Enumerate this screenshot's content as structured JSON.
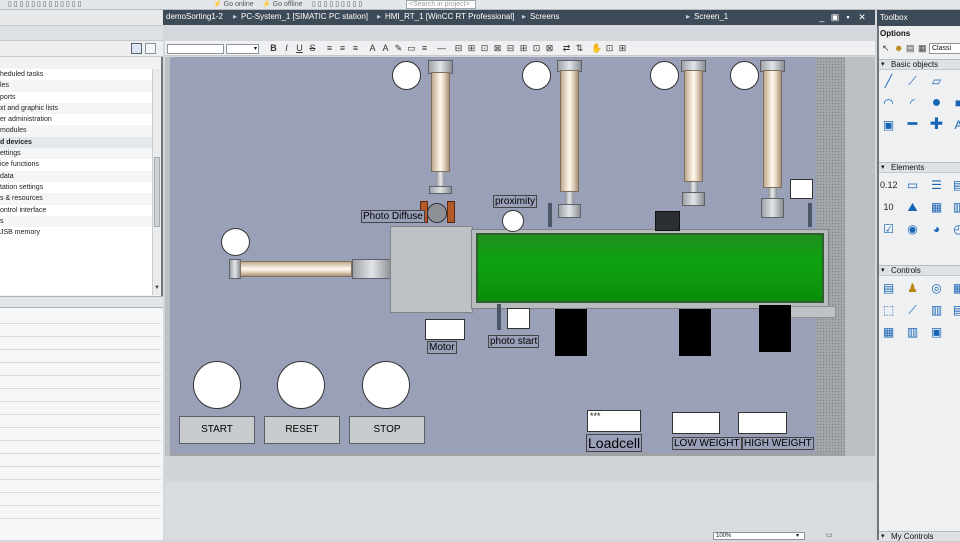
{
  "top_toolbar": {
    "go_online": "Go online",
    "go_offline": "Go offline",
    "search_placeholder": "<Search in project>"
  },
  "breadcrumb": [
    "demoSorting1-2",
    "PC-System_1 [SIMATIC PC station]",
    "HMI_RT_1 [WinCC RT Professional]",
    "Screens",
    "Screen_1"
  ],
  "breadcrumb_sep": "▸",
  "window_buttons": [
    "_",
    "▣",
    "▪",
    "✕"
  ],
  "project_tree": [
    {
      "label": "heduled tasks",
      "bold": false
    },
    {
      "label": "les",
      "bold": false
    },
    {
      "label": "ports",
      "bold": false
    },
    {
      "label": "xt and graphic lists",
      "bold": false
    },
    {
      "label": "er administration",
      "bold": false
    },
    {
      "label": "modules",
      "bold": false
    },
    {
      "label": "d devices",
      "bold": true
    },
    {
      "label": "ettings",
      "bold": false
    },
    {
      "label": "ice functions",
      "bold": false
    },
    {
      "label": "data",
      "bold": false
    },
    {
      "label": "tation settings",
      "bold": false
    },
    {
      "label": "s & resources",
      "bold": false
    },
    {
      "label": "ontrol interface",
      "bold": false
    },
    {
      "label": "s",
      "bold": false
    },
    {
      "label": "JSB memory",
      "bold": false
    }
  ],
  "format_toolbar": {
    "icons": [
      "B",
      "I",
      "U",
      "S",
      "≡",
      "≡",
      "≡",
      "A",
      "A",
      "✎",
      "▭",
      "≡",
      "—",
      "⊟",
      "⊞",
      "⊡",
      "⊠",
      "⊟",
      "⊞",
      "⊡",
      "⊠",
      "⇄",
      "⇅",
      "✋",
      "⊡",
      "⊞"
    ]
  },
  "canvas": {
    "labels": {
      "photo_diffuse": "Photo Diffuse",
      "proximity": "proximity",
      "motor": "Motor",
      "photo_start": "photo start",
      "loadcell": "Loadcell",
      "low_weight": "LOW WEIGHT",
      "high_weight": "HIGH WEIGHT",
      "loadcell_value": "***"
    },
    "buttons": {
      "start": "START",
      "reset": "RESET",
      "stop": "STOP"
    }
  },
  "status": {
    "zoom": "100%"
  },
  "toolbox": {
    "title": "Toolbox",
    "options_label": "Options",
    "options_view": "Classi",
    "sections": {
      "basic_objects": "Basic objects",
      "elements": "Elements",
      "controls": "Controls",
      "my_controls": "My Controls"
    },
    "section_arrow": "▾"
  }
}
